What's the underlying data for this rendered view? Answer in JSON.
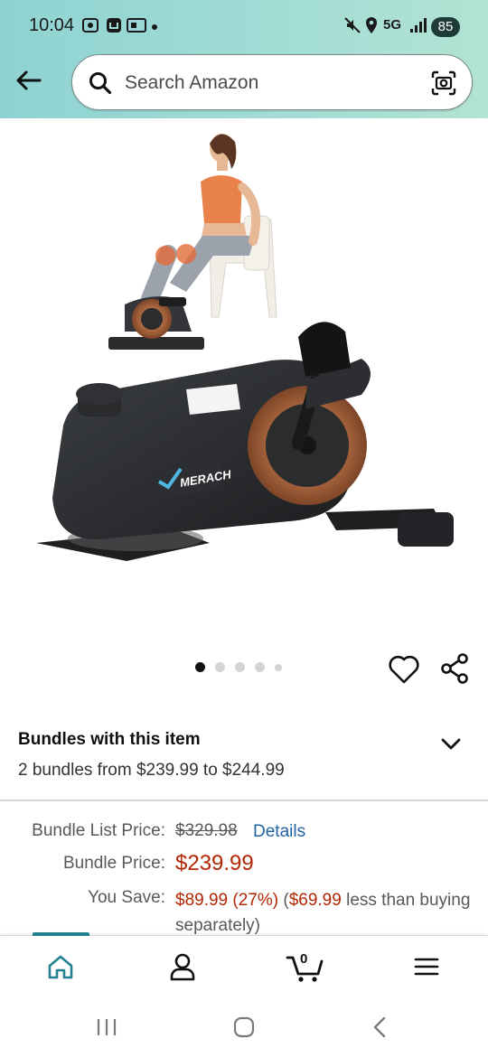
{
  "status_bar": {
    "time": "10:04",
    "network": "5G",
    "battery": "85"
  },
  "search": {
    "placeholder": "Search Amazon"
  },
  "product": {
    "brand_mark": "MERACH",
    "image_count": 5,
    "active_image": 1
  },
  "bundles": {
    "title": "Bundles with this item",
    "subtitle": "2 bundles from $239.99 to $244.99"
  },
  "pricing": {
    "list_label": "Bundle List Price:",
    "list_price": "$329.98",
    "details_link": "Details",
    "bundle_label": "Bundle Price:",
    "bundle_price": "$239.99",
    "save_label": "You Save:",
    "save_amount": "$89.99 (27%)",
    "save_open": "(",
    "separate_amount": "$69.99",
    "save_tail": "less than buying separately)"
  },
  "bottom_nav": {
    "cart_count": "0"
  },
  "colors": {
    "accent_teal": "#22818f",
    "price_red": "#b12704",
    "link_blue": "#2162a1"
  },
  "icons": [
    "back-arrow-icon",
    "search-icon",
    "camera-scan-icon",
    "heart-icon",
    "share-icon",
    "chevron-down-icon",
    "home-icon",
    "profile-icon",
    "cart-icon",
    "menu-icon"
  ]
}
